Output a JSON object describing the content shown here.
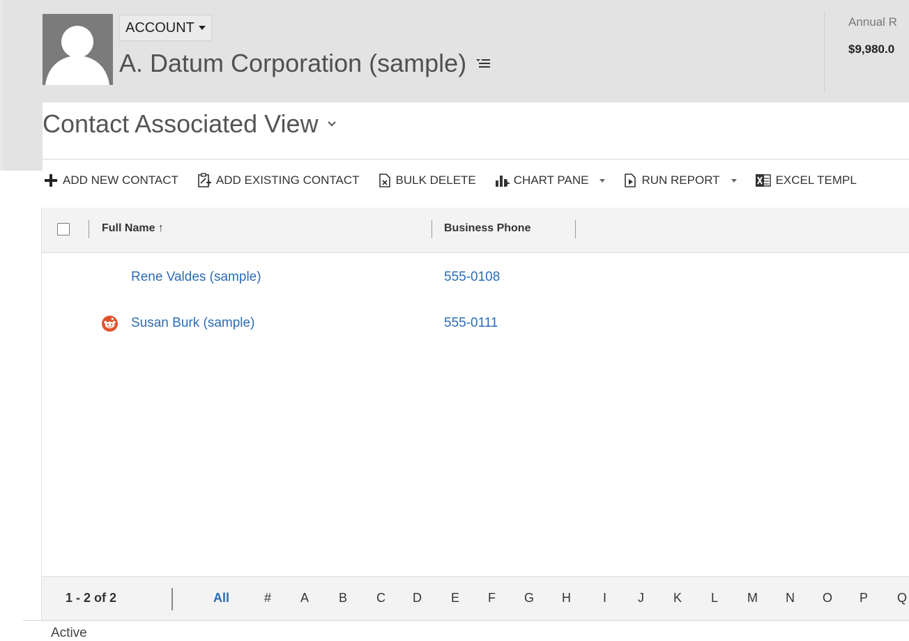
{
  "header": {
    "entity_label": "ACCOUNT",
    "record_title": "A. Datum Corporation (sample)",
    "kpi_label": "Annual R",
    "kpi_value": "$9,980.0"
  },
  "view": {
    "title": "Contact Associated View"
  },
  "commands": [
    {
      "label": "ADD NEW CONTACT",
      "icon": "plus-icon"
    },
    {
      "label": "ADD EXISTING CONTACT",
      "icon": "add-existing-icon"
    },
    {
      "label": "BULK DELETE",
      "icon": "bulk-delete-icon"
    },
    {
      "label": "CHART PANE",
      "icon": "chart-icon",
      "has_dropdown": true
    },
    {
      "label": "RUN REPORT",
      "icon": "report-icon",
      "has_dropdown": true
    },
    {
      "label": "EXCEL TEMPL",
      "icon": "excel-icon"
    }
  ],
  "grid": {
    "columns": [
      "Full Name",
      "Business Phone"
    ],
    "sort_indicator": "↑",
    "rows": [
      {
        "full_name": "Rene Valdes (sample)",
        "business_phone": "555-0108",
        "icon": ""
      },
      {
        "full_name": "Susan Burk (sample)",
        "business_phone": "555-0111",
        "icon": "reddit-icon"
      }
    ]
  },
  "footer": {
    "record_count": "1 - 2 of 2",
    "letters": [
      "All",
      "#",
      "A",
      "B",
      "C",
      "D",
      "E",
      "F",
      "G",
      "H",
      "I",
      "J",
      "K",
      "L",
      "M",
      "N",
      "O",
      "P",
      "Q"
    ],
    "active_letter": "All"
  },
  "status": {
    "text": "Active"
  },
  "colors": {
    "link": "#2b6cb3",
    "header_bg": "#e3e3e3",
    "row_icon": "#e0522b"
  }
}
